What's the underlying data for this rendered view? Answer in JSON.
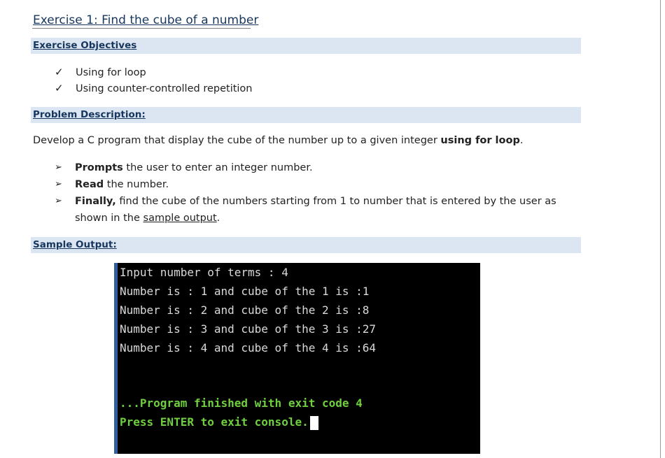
{
  "exercise": {
    "title": "Exercise 1: Find the cube of a number"
  },
  "objectives": {
    "heading": "Exercise Objectives",
    "items": [
      {
        "mark": "✓",
        "text": "Using for loop"
      },
      {
        "mark": "✓",
        "text": "Using counter-controlled repetition"
      }
    ]
  },
  "problem": {
    "heading": "Problem Description:",
    "intro_text": "Develop a C program that display the cube of the number up to a given integer ",
    "intro_bold": "using for loop",
    "intro_end": ".",
    "steps": [
      {
        "bold": "Prompts",
        "text": " the user to enter an integer number."
      },
      {
        "bold": "Read",
        "text": " the number."
      },
      {
        "bold": "Finally,",
        "text": " find the cube of the numbers starting from 1 to number that is entered by the user as shown in the ",
        "link": "sample output",
        "end": "."
      }
    ]
  },
  "sample": {
    "heading": "Sample Output:"
  },
  "console": {
    "lines": [
      "Input number of terms : 4",
      "Number is : 1 and cube of the 1 is :1",
      "Number is : 2 and cube of the 2 is :8",
      "Number is : 3 and cube of the 3 is :27",
      "Number is : 4 and cube of the 4 is :64"
    ],
    "finish_line": "...Program finished with exit code 4",
    "exit_line": "Press ENTER to exit console.",
    "text_color": "#d9d9d9",
    "status_color": "#6fcf3f"
  }
}
